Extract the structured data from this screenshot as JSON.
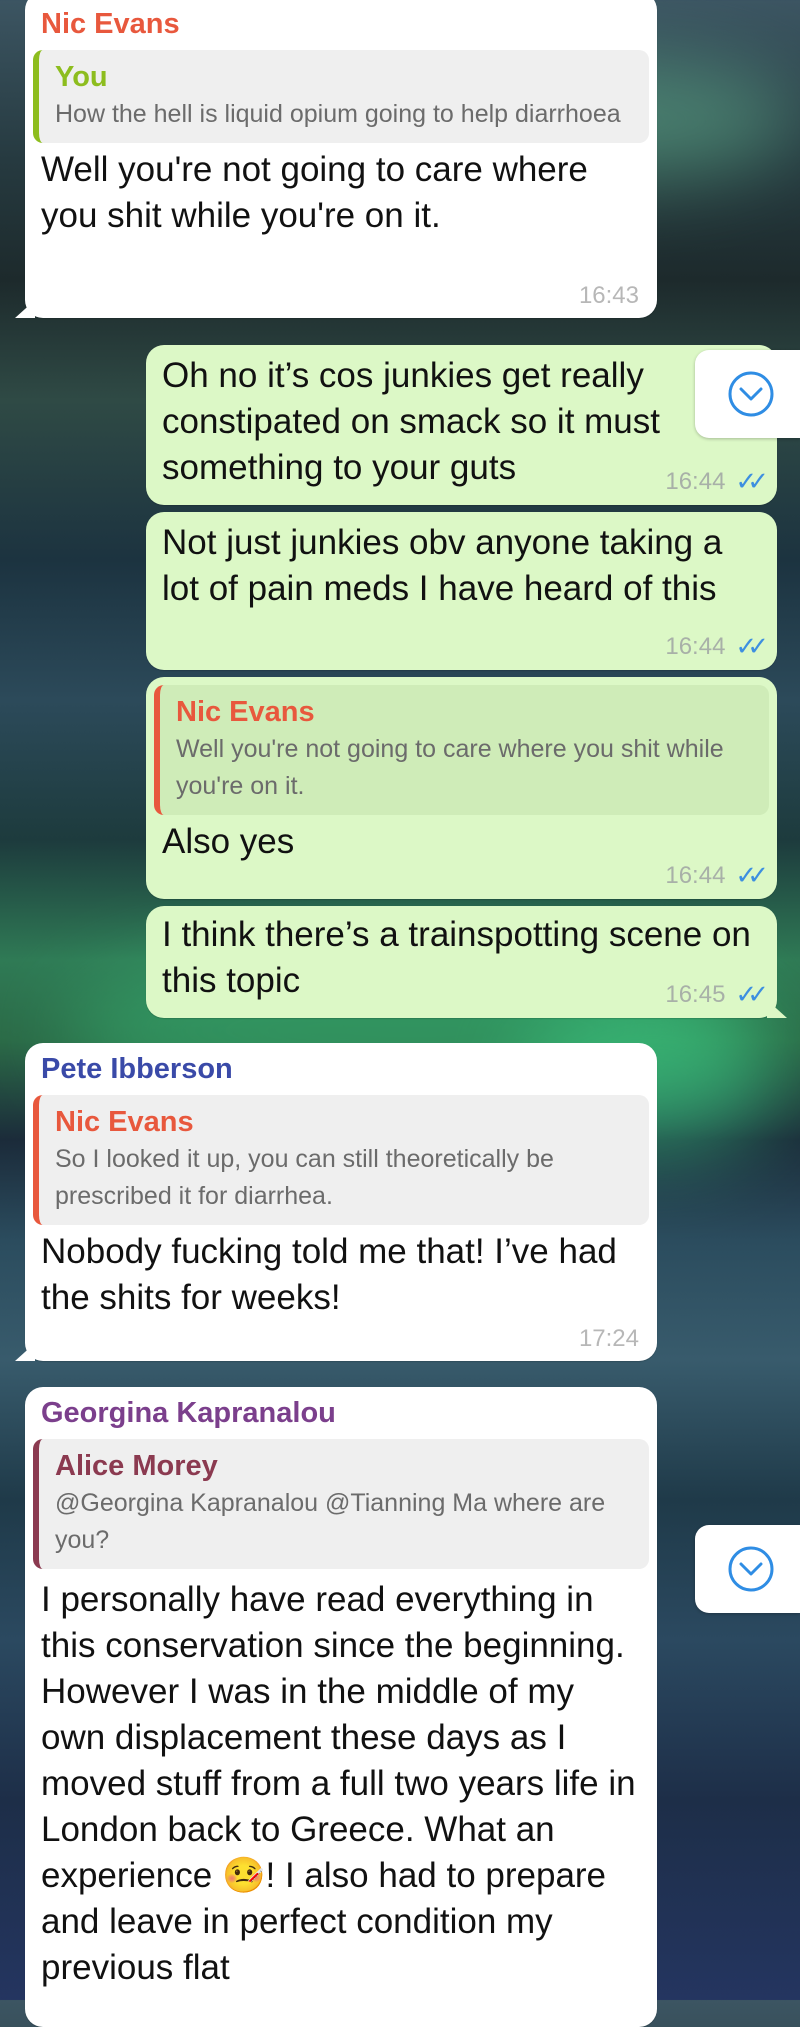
{
  "messages": [
    {
      "sender": "Nic Evans",
      "quote_name": "You",
      "quote_text": "How the hell is liquid opium going to help diarrhoea",
      "text": "Well you're not going to care where you shit while you're on it.",
      "time": "16:43"
    },
    {
      "text": "Oh no it’s cos junkies get really constipated on smack so it must something to your guts",
      "time": "16:44"
    },
    {
      "text": "Not just junkies obv anyone taking a lot of pain meds I have heard of this",
      "time": "16:44"
    },
    {
      "quote_name": "Nic Evans",
      "quote_text": "Well you're not going to care where you shit while you're on it.",
      "text": "Also yes",
      "time": "16:44"
    },
    {
      "text": "I think there’s a trainspotting scene on this topic",
      "time": "16:45"
    },
    {
      "sender": "Pete Ibberson",
      "quote_name": "Nic Evans",
      "quote_text": "So I looked it up, you can still theoretically be prescribed it for diarrhea.",
      "text": "Nobody fucking told me that! I’ve had the shits for weeks!",
      "time": "17:24"
    },
    {
      "sender": "Georgina Kapranalou",
      "quote_name": "Alice Morey",
      "quote_text": "@Georgina Kapranalou @Tianning Ma where are you?",
      "text": "I personally have read everything in this conservation since the beginning. However I was in the middle of my own displacement these days as I moved stuff from a full two years life in London back to Greece. What an experience 🤒! I also had to prepare and leave in perfect condition my previous flat"
    }
  ],
  "colors": {
    "nic_evans": "#e8583d",
    "you": "#8dbd1e",
    "pete_ibberson": "#3a4aa8",
    "georgina": "#7b3f8c",
    "alice_morey": "#8b3a50",
    "out_bubble": "#dcf8c6",
    "read_ticks": "#3d8fe0"
  },
  "icons": {
    "scroll_down": "chevron-down-circle-icon",
    "read_receipt": "double-check-icon"
  }
}
